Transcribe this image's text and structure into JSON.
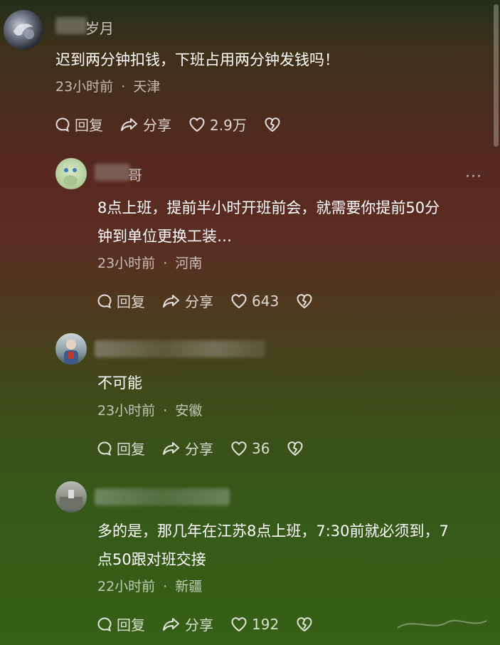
{
  "comments": [
    {
      "username_suffix": "岁月",
      "text": "迟到两分钟扣钱，下班占用两分钟发钱吗！",
      "time": "23小时前",
      "location": "天津",
      "reply_label": "回复",
      "share_label": "分享",
      "likes": "2.9万"
    },
    {
      "username_suffix": "哥",
      "text_lines": [
        "8点上班，提前半小时开班前会，就需要你提前50分",
        "钟到单位更换工装…"
      ],
      "time": "23小时前",
      "location": "河南",
      "reply_label": "回复",
      "share_label": "分享",
      "likes": "643",
      "more_label": "···"
    },
    {
      "text": "不可能",
      "time": "23小时前",
      "location": "安徽",
      "reply_label": "回复",
      "share_label": "分享",
      "likes": "36"
    },
    {
      "text_lines": [
        "多的是，那几年在江苏8点上班，7:30前就必须到，7",
        "点50跟对班交接"
      ],
      "time": "22小时前",
      "location": "新疆",
      "reply_label": "回复",
      "share_label": "分享",
      "likes": "192"
    }
  ],
  "icons": {
    "reply": "speech-bubble-icon",
    "share": "share-arrow-icon",
    "like": "heart-icon",
    "dislike": "broken-heart-icon"
  },
  "separator": "·"
}
